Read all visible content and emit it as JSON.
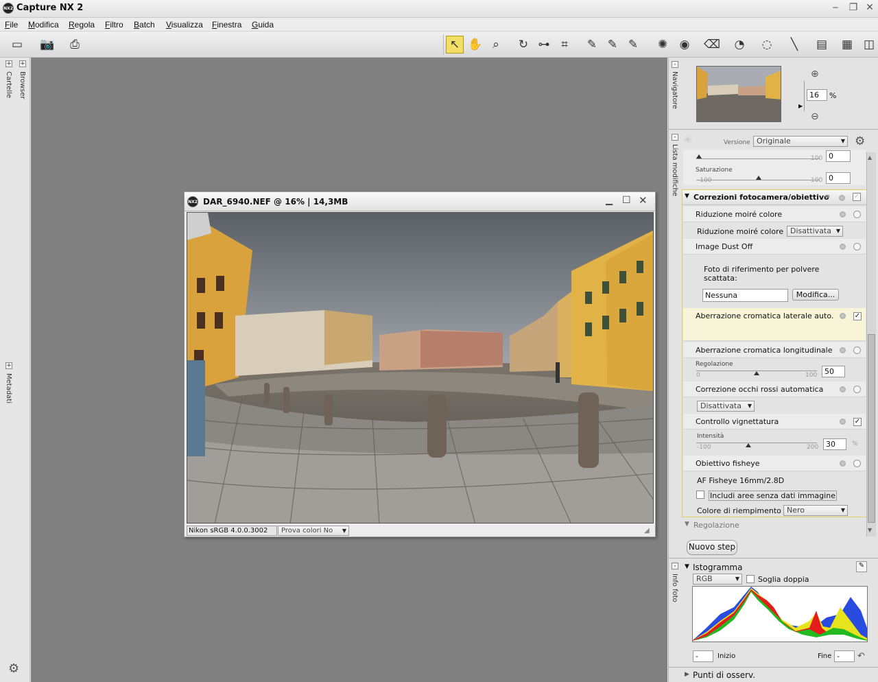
{
  "app": {
    "title": "Capture NX 2",
    "logo": "NX2"
  },
  "menu": [
    "File",
    "Modifica",
    "Regola",
    "Filtro",
    "Batch",
    "Visualizza",
    "Finestra",
    "Guida"
  ],
  "left_panel": {
    "tabs": [
      "Cartelle",
      "Browser",
      "Metadati"
    ]
  },
  "image_window": {
    "title": "DAR_6940.NEF @ 16% | 14,3MB",
    "profile": "Nikon sRGB 4.0.0.3002",
    "softproof": "Prova colori No"
  },
  "navigator": {
    "tab": "Navigatore",
    "zoom_value": "16",
    "zoom_unit": "%"
  },
  "edit_list": {
    "tab": "Lista modifiche",
    "version_label": "Versione",
    "version_value": "Originale",
    "top_slider": {
      "min": "-100",
      "max": "100",
      "value": "0"
    },
    "saturation": {
      "label": "Saturazione",
      "min": "-100",
      "max": "100",
      "value": "0"
    },
    "section_title": "Correzioni fotocamera/obiettivo",
    "moire": {
      "title": "Riduzione moiré colore",
      "label": "Riduzione moiré colore",
      "value": "Disattivata"
    },
    "dust": {
      "title": "Image Dust Off",
      "text": "Foto di riferimento per polvere scattata:",
      "field": "Nessuna",
      "button": "Modifica..."
    },
    "lateral_ca": {
      "title": "Aberrazione cromatica laterale auto.",
      "checked": true
    },
    "long_ca": {
      "title": "Aberrazione cromatica longitudinale",
      "label": "Regolazione",
      "min": "0",
      "max": "100",
      "value": "50",
      "level": 0.5
    },
    "redeye": {
      "title": "Correzione occhi rossi automatica",
      "value": "Disattivata"
    },
    "vignette": {
      "title": "Controllo vignettatura",
      "checked": true,
      "label": "Intensità",
      "min": "-100",
      "max": "200",
      "value": "30",
      "unit": "%",
      "level": 0.43
    },
    "fisheye": {
      "title": "Obiettivo fisheye",
      "lens": "AF Fisheye 16mm/2.8D",
      "include_label": "Includi aree senza dati immagine",
      "fill_label": "Colore di riempimento",
      "fill_value": "Nero"
    },
    "adjust": "Regolazione",
    "new_step": "Nuovo step"
  },
  "histogram": {
    "tab": "Info foto",
    "title": "Istogramma",
    "channel": "RGB",
    "double": "Soglia doppia",
    "start_label": "Inizio",
    "start_value": "-",
    "end_label": "Fine",
    "end_value": "-"
  },
  "watch_points": "Punti di osserv.",
  "colors": {
    "active_tool": "#f2e066",
    "panel_highlight": "#f7f4d8",
    "canvas": "#808080"
  }
}
